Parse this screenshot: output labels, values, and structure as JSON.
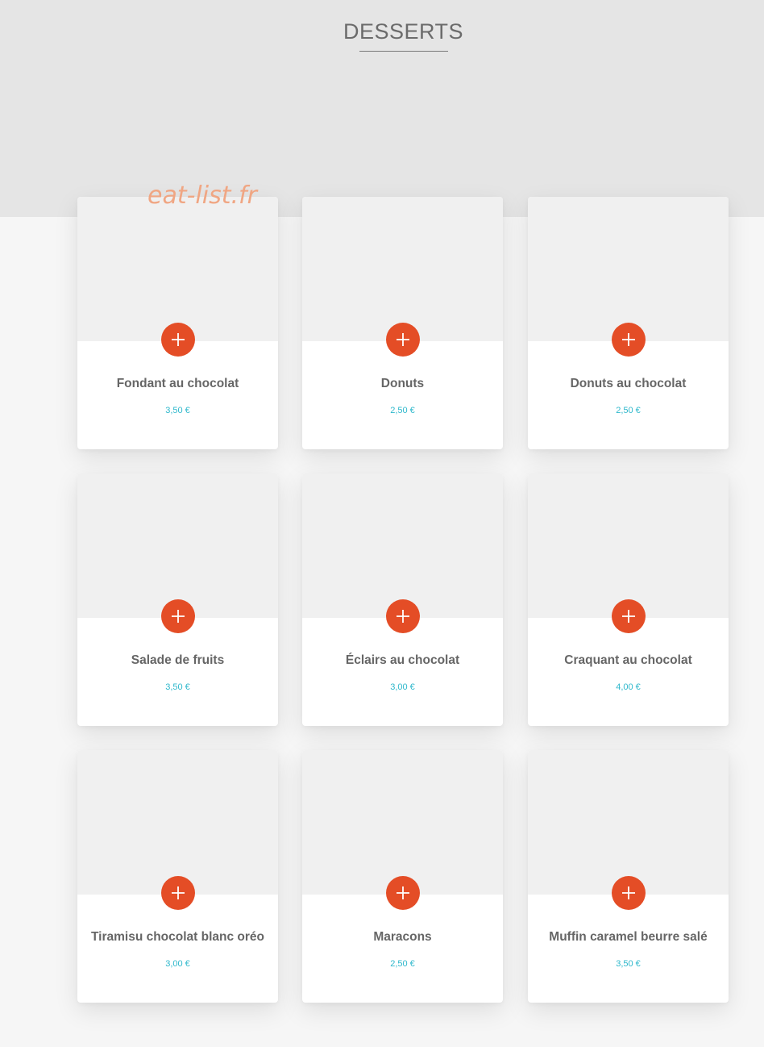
{
  "header": {
    "title": "DESSERTS"
  },
  "watermark": "eat-list.fr",
  "colors": {
    "accent": "#e44d26",
    "price": "#2fb8cc",
    "band": "#e5e5e5",
    "watermark": "#f0a683"
  },
  "add_icon": "plus-icon",
  "items": [
    {
      "name": "Fondant au chocolat",
      "price": "3,50 €"
    },
    {
      "name": "Donuts",
      "price": "2,50 €"
    },
    {
      "name": "Donuts au chocolat",
      "price": "2,50 €"
    },
    {
      "name": "Salade de fruits",
      "price": "3,50 €"
    },
    {
      "name": "Éclairs au chocolat",
      "price": "3,00 €"
    },
    {
      "name": "Craquant au chocolat",
      "price": "4,00 €"
    },
    {
      "name": "Tiramisu chocolat blanc oréo",
      "price": "3,00 €"
    },
    {
      "name": "Maracons",
      "price": "2,50 €"
    },
    {
      "name": "Muffin caramel beurre salé",
      "price": "3,50 €"
    }
  ]
}
